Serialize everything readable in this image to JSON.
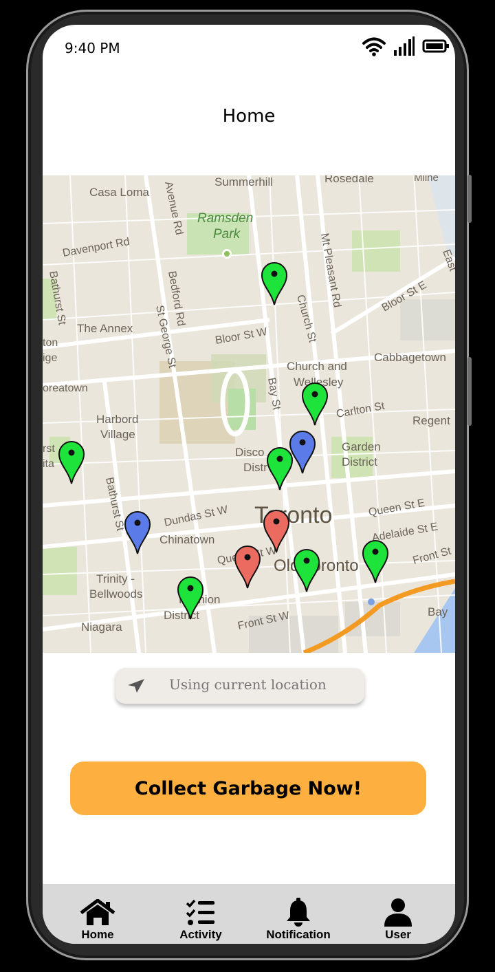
{
  "status_bar": {
    "time": "9:40 PM",
    "icons": [
      "wifi-icon",
      "signal-icon",
      "battery-icon"
    ]
  },
  "header": {
    "title": "Home"
  },
  "map": {
    "labels": {
      "summerhill": "Summerhill",
      "rosedale": "Rosedale",
      "casa_loma": "Casa Loma",
      "ramsden_park": "Ramsden",
      "ramsden_park_2": "Park",
      "avenue_rd": "Avenue Rd",
      "davenport": "Davenport Rd",
      "mt_pleasant": "Mt Pleasant Rd",
      "bloor_e": "Bloor St E",
      "church": "Church St",
      "bedford": "Bedford Rd",
      "st_george": "St George St",
      "annex": "The Annex",
      "bloor_w": "Bloor St W",
      "church_wellesley": "Church and",
      "church_wellesley_2": "Wellesley",
      "cabbagetown": "Cabbagetown",
      "koreatown": "oreatown",
      "bay": "Bay St",
      "carlton": "Carlton St",
      "regent": "Regent",
      "harbord": "Harbord",
      "harbord_2": "Village",
      "garden": "Garden",
      "garden_2": "District",
      "discovery": "Disco",
      "discovery_2": "Distr",
      "bathurst": "Bathurst St",
      "dundas": "Dundas St W",
      "toronto": "Toronto",
      "queen_e": "Queen St E",
      "adelaide": "Adelaide St E",
      "chinatown": "Chinatown",
      "queen_w": "Queen St W",
      "old_toronto": "Old Toronto",
      "front_e": "Front St",
      "trinity": "Trinity -",
      "trinity_2": "Bellwoods",
      "fashion": "Fashion",
      "fashion_2": "District",
      "front_w": "Front St W",
      "niagara": "Niagara",
      "bay_side": "Bay",
      "east": "East",
      "ton": "ton",
      "ige": "ige",
      "rst": "rst",
      "ita": "ita",
      "milne": "Milne"
    },
    "pin_colors": {
      "green": "#1ee33b",
      "blue": "#5b7be8",
      "red": "#ec6b61"
    },
    "pins": [
      {
        "color": "green",
        "icon": "map-pin-icon"
      },
      {
        "color": "green",
        "icon": "map-pin-icon"
      },
      {
        "color": "blue",
        "icon": "map-pin-icon"
      },
      {
        "color": "green",
        "icon": "map-pin-icon"
      },
      {
        "color": "green",
        "icon": "map-pin-icon"
      },
      {
        "color": "blue",
        "icon": "map-pin-icon"
      },
      {
        "color": "red",
        "icon": "map-pin-icon"
      },
      {
        "color": "red",
        "icon": "map-pin-icon"
      },
      {
        "color": "green",
        "icon": "map-pin-icon"
      },
      {
        "color": "green",
        "icon": "map-pin-icon"
      },
      {
        "color": "green",
        "icon": "map-pin-icon"
      }
    ]
  },
  "location": {
    "icon": "navigation-arrow-icon",
    "text": "Using current location"
  },
  "cta": {
    "label": "Collect Garbage Now!",
    "color": "#fdb03f"
  },
  "nav": {
    "items": [
      {
        "label": "Home",
        "icon": "home-icon"
      },
      {
        "label": "Activity",
        "icon": "checklist-icon"
      },
      {
        "label": "Notification",
        "icon": "bell-icon"
      },
      {
        "label": "User",
        "icon": "user-icon"
      }
    ]
  }
}
